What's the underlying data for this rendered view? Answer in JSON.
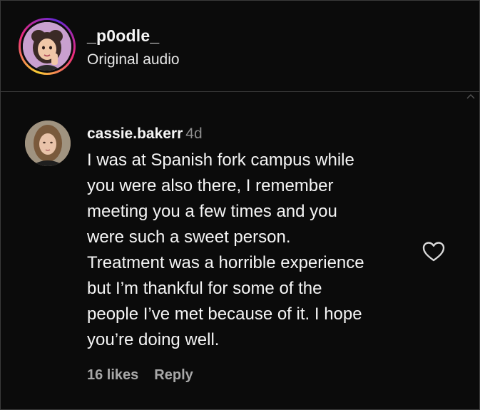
{
  "post": {
    "username": "_p0odle_",
    "audio_label": "Original audio"
  },
  "comment": {
    "username": "cassie.bakerr",
    "time": "4d",
    "text": "I was at Spanish fork campus while\nyou were also there, I remember\nmeeting you a few times and you\nwere such a sweet person.\nTreatment was a horrible experience\nbut I’m thankful for some of the\npeople I’ve met because of it. I hope\nyou’re doing well.",
    "likes": "16 likes",
    "reply_label": "Reply"
  },
  "colors": {
    "background": "#0b0b0b",
    "divider": "#3a3a3a",
    "text_primary": "#f5f5f5",
    "text_secondary": "#a8a8a8",
    "timestamp": "#8e8e8e",
    "story_ring": [
      "#f9ce34",
      "#ee2a7b",
      "#6228d7"
    ]
  },
  "icons": {
    "like": "heart-outline-icon",
    "scroll": "chevron-up-icon"
  }
}
